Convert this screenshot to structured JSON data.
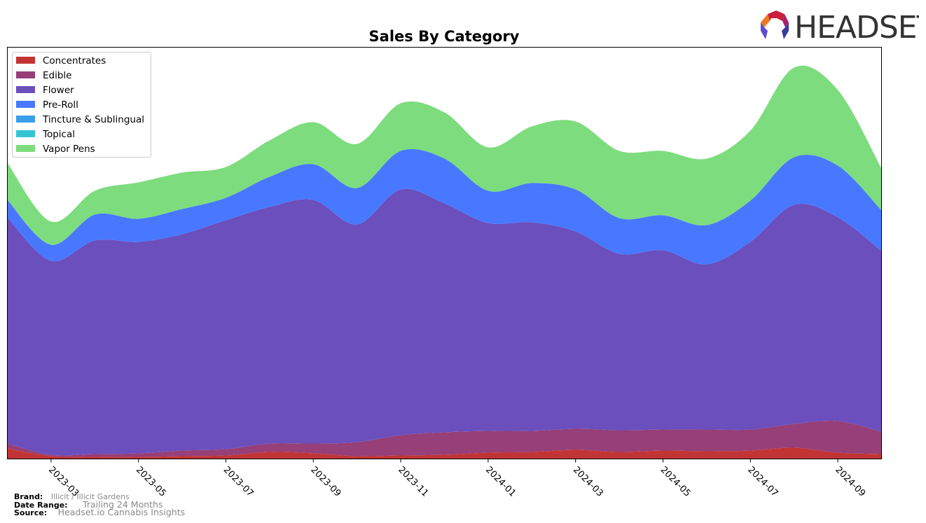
{
  "chart_data": {
    "type": "area",
    "stacked": true,
    "smoothed": true,
    "title": "Sales By Category",
    "xlabel": "",
    "ylabel": "",
    "y_axis_visible": false,
    "grid": false,
    "legend_position": "top-left",
    "x": [
      "2023-02",
      "2023-03",
      "2023-04",
      "2023-05",
      "2023-06",
      "2023-07",
      "2023-08",
      "2023-09",
      "2023-10",
      "2023-11",
      "2023-12",
      "2024-01",
      "2024-02",
      "2024-03",
      "2024-04",
      "2024-05",
      "2024-06",
      "2024-07",
      "2024-08",
      "2024-09",
      "2024-10"
    ],
    "x_tick_labels": [
      "2023-03",
      "2023-05",
      "2023-07",
      "2023-09",
      "2023-11",
      "2024-01",
      "2024-03",
      "2024-05",
      "2024-07",
      "2024-09"
    ],
    "ylim": [
      0,
      588
    ],
    "series": [
      {
        "name": "Concentrates",
        "color": "#c23434",
        "values": [
          15,
          4,
          3,
          3,
          4,
          5,
          10,
          8,
          4,
          5,
          6,
          9,
          10,
          13,
          10,
          12,
          11,
          12,
          16,
          9,
          7
        ]
      },
      {
        "name": "Edible",
        "color": "#963f78",
        "values": [
          7,
          2,
          4,
          5,
          8,
          9,
          12,
          14,
          20,
          29,
          32,
          31,
          30,
          30,
          31,
          30,
          31,
          30,
          34,
          45,
          32
        ]
      },
      {
        "name": "Flower",
        "color": "#6a4fbd",
        "values": [
          323,
          277,
          305,
          302,
          309,
          327,
          338,
          348,
          311,
          351,
          327,
          297,
          298,
          282,
          252,
          256,
          236,
          268,
          313,
          291,
          258
        ]
      },
      {
        "name": "Pre-Roll",
        "color": "#4878ff",
        "values": [
          25,
          23,
          37,
          33,
          36,
          32,
          43,
          51,
          52,
          55,
          64,
          46,
          56,
          60,
          51,
          50,
          56,
          59,
          68,
          74,
          58
        ]
      },
      {
        "name": "Tincture & Sublingual",
        "color": "#3b9ee8",
        "values": [
          0,
          0,
          0,
          0,
          0,
          0,
          0,
          0,
          0,
          0,
          0,
          0,
          0,
          0,
          0,
          0,
          0,
          0,
          0,
          0,
          0
        ]
      },
      {
        "name": "Topical",
        "color": "#35c4d4",
        "values": [
          0,
          0,
          0,
          0,
          0,
          0,
          0,
          0,
          0,
          0,
          0,
          0,
          0,
          0,
          0,
          0,
          0,
          0,
          0,
          0,
          0
        ]
      },
      {
        "name": "Vapor Pens",
        "color": "#7ddc7e",
        "values": [
          53,
          33,
          34,
          52,
          52,
          44,
          52,
          60,
          63,
          68,
          66,
          62,
          81,
          97,
          96,
          92,
          95,
          100,
          128,
          108,
          60
        ]
      }
    ]
  },
  "footer": {
    "brand_label": "Brand:",
    "brand_value": "Illicit / Illicit Gardens",
    "date_range_label": "Date Range:",
    "date_range_value": "Trailing 24 Months",
    "source_label": "Source:",
    "source_value": "Headset.io Cannabis Insights"
  },
  "logo": {
    "text": "HEADSET"
  }
}
